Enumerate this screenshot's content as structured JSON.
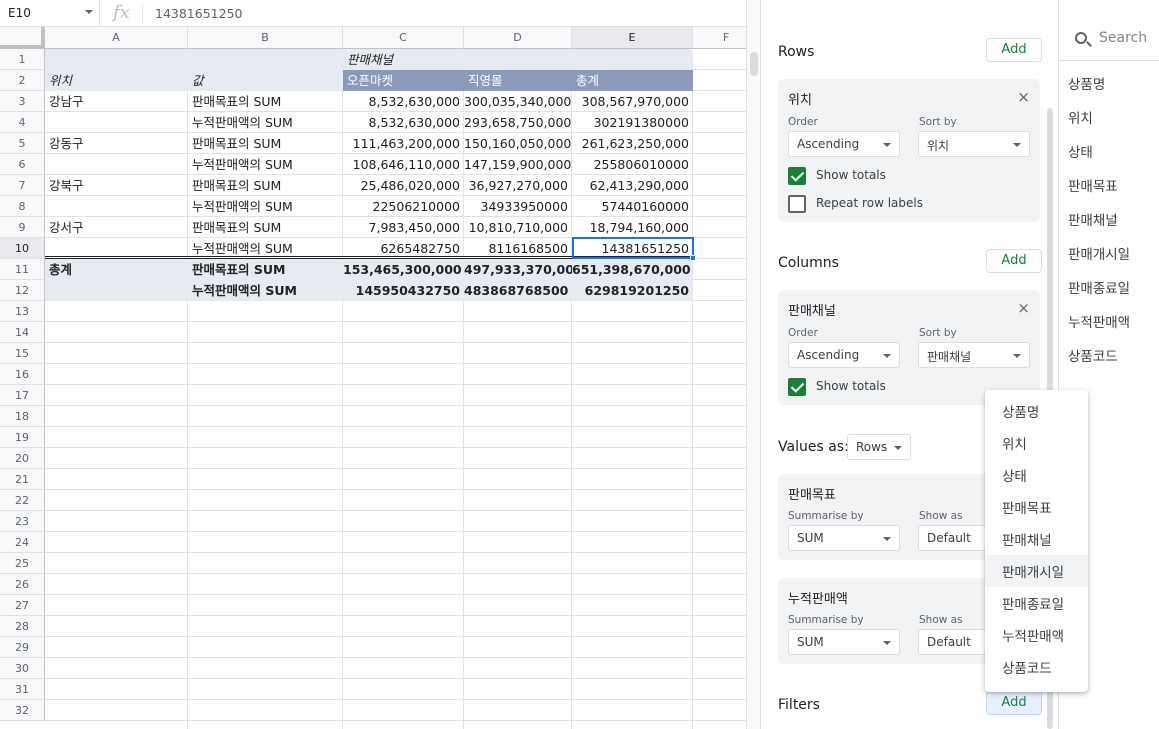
{
  "formula": {
    "cell_ref": "E10",
    "fx": "fx",
    "value": "14381651250"
  },
  "sheet": {
    "columns": [
      "A",
      "B",
      "C",
      "D",
      "E",
      "F"
    ],
    "rows": [
      "1",
      "2",
      "3",
      "4",
      "5",
      "6",
      "7",
      "8",
      "9",
      "10",
      "11",
      "12",
      "13",
      "14",
      "15",
      "16",
      "17",
      "18",
      "19",
      "20",
      "21",
      "22",
      "23",
      "24",
      "25",
      "26",
      "27",
      "28",
      "29",
      "30",
      "31",
      "32"
    ],
    "selected_column": "E",
    "selected_row": "10"
  },
  "pivot": {
    "r1": [
      "",
      "",
      "판매채널",
      "",
      ""
    ],
    "r2": [
      "위치",
      "값",
      "오픈마켓",
      "직영몰",
      "총계"
    ],
    "body": [
      [
        "강남구",
        "판매목표의 SUM",
        "8,532,630,000",
        "300,035,340,000",
        "308,567,970,000"
      ],
      [
        "",
        "누적판매액의 SUM",
        "8,532,630,000",
        "293,658,750,000",
        "302191380000"
      ],
      [
        "강동구",
        "판매목표의 SUM",
        "111,463,200,000",
        "150,160,050,000",
        "261,623,250,000"
      ],
      [
        "",
        "누적판매액의 SUM",
        "108,646,110,000",
        "147,159,900,000",
        "255806010000"
      ],
      [
        "강북구",
        "판매목표의 SUM",
        "25,486,020,000",
        "36,927,270,000",
        "62,413,290,000"
      ],
      [
        "",
        "누적판매액의 SUM",
        "22506210000",
        "34933950000",
        "57440160000"
      ],
      [
        "강서구",
        "판매목표의 SUM",
        "7,983,450,000",
        "10,810,710,000",
        "18,794,160,000"
      ],
      [
        "",
        "누적판매액의 SUM",
        "6265482750",
        "8116168500",
        "14381651250"
      ]
    ],
    "totals": [
      [
        "총계",
        "판매목표의 SUM",
        "153,465,300,000",
        "497,933,370,000",
        "651,398,670,000"
      ],
      [
        "",
        "누적판매액의 SUM",
        "145950432750",
        "483868768500",
        "629819201250"
      ]
    ]
  },
  "editor": {
    "rows_title": "Rows",
    "columns_title": "Columns",
    "values_as_label": "Values as:",
    "values_as_value": "Rows",
    "filters_title": "Filters",
    "add_label": "Add",
    "order_label": "Order",
    "sort_by_label": "Sort by",
    "ascending": "Ascending",
    "show_totals": "Show totals",
    "repeat_row_labels": "Repeat row labels",
    "summarise_by_label": "Summarise by",
    "show_as_label": "Show as",
    "sum": "SUM",
    "default": "Default",
    "close_symbol": "×",
    "row_card": {
      "title": "위치",
      "sort_by": "위치",
      "show_totals": true,
      "repeat_row_labels": false
    },
    "column_card": {
      "title": "판매채널",
      "sort_by": "판매채널",
      "show_totals": true
    },
    "value_cards": [
      {
        "title": "판매목표"
      },
      {
        "title": "누적판매액"
      }
    ]
  },
  "field_list": {
    "search_placeholder": "Search",
    "items": [
      "상품명",
      "위치",
      "상태",
      "판매목표",
      "판매채널",
      "판매개시일",
      "판매종료일",
      "누적판매액",
      "상품코드"
    ]
  },
  "dropdown_menu": {
    "items": [
      "상품명",
      "위치",
      "상태",
      "판매목표",
      "판매채널",
      "판매개시일",
      "판매종료일",
      "누적판매액",
      "상품코드"
    ],
    "hovered": "판매개시일"
  },
  "colors": {
    "accent_green": "#188038",
    "selection_blue": "#1a73e8",
    "pivot_header_blue": "#8b99bb",
    "pivot_band_gray": "#e8eaf2"
  }
}
